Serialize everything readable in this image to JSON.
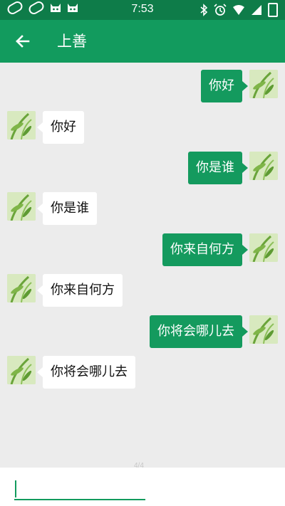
{
  "status_bar": {
    "time": "7:53",
    "icons_left": [
      "pill-icon",
      "pill-icon",
      "android-icon",
      "android-icon"
    ],
    "icons_right": [
      "bluetooth-icon",
      "alarm-icon",
      "wifi-icon",
      "signal-icon",
      "battery-icon"
    ]
  },
  "app_bar": {
    "title": "上善",
    "back_icon": "arrow-left-icon",
    "background_color": "#129b5e"
  },
  "messages": [
    {
      "direction": "outgoing",
      "text": "你好"
    },
    {
      "direction": "incoming",
      "text": "你好"
    },
    {
      "direction": "outgoing",
      "text": "你是谁"
    },
    {
      "direction": "incoming",
      "text": "你是谁"
    },
    {
      "direction": "outgoing",
      "text": "你来自何方"
    },
    {
      "direction": "incoming",
      "text": "你来自何方"
    },
    {
      "direction": "outgoing",
      "text": "你将会哪儿去"
    },
    {
      "direction": "incoming",
      "text": "你将会哪儿去"
    }
  ],
  "colors": {
    "outgoing_bubble": "#149a5e",
    "incoming_bubble": "#ffffff",
    "chat_background": "#ececec"
  },
  "input": {
    "value": "",
    "placeholder": ""
  },
  "page_indicator": "4/4"
}
